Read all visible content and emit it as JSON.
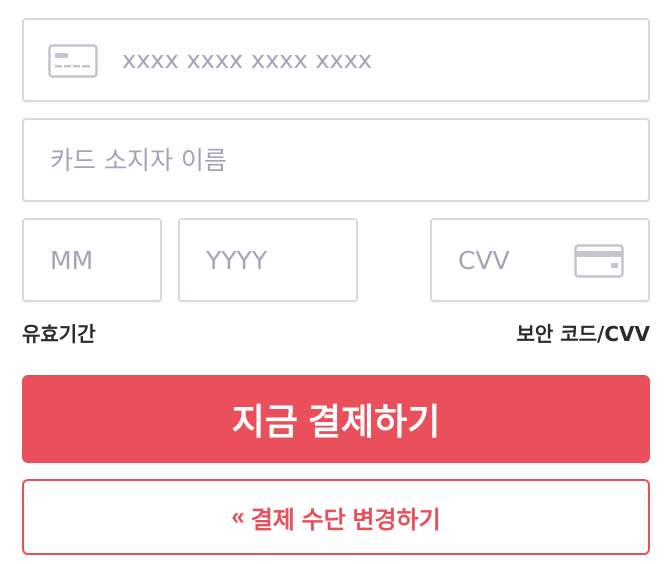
{
  "card_number": {
    "placeholder": "xxxx xxxx xxxx xxxx",
    "value": "",
    "icon": "card-front-icon"
  },
  "card_holder": {
    "placeholder": "카드 소지자 이름",
    "value": ""
  },
  "expiry": {
    "month_placeholder": "MM",
    "year_placeholder": "YYYY",
    "caption": "유효기간"
  },
  "cvv": {
    "placeholder": "CVV",
    "icon": "card-back-icon",
    "caption": "보안 코드/CVV"
  },
  "actions": {
    "pay_label": "지금 결제하기",
    "change_method_chevron": "«",
    "change_method_label": "결제 수단 변경하기"
  },
  "colors": {
    "accent": "#e9505b",
    "field_border": "#d9d9e2",
    "placeholder": "#a4a4b8",
    "text": "#2a2a33"
  }
}
